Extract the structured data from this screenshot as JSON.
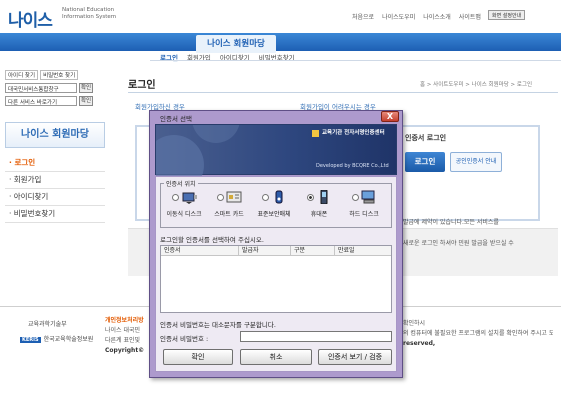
{
  "header": {
    "logo_ko": "나이스",
    "logo_en_line1": "National Education",
    "logo_en_line2": "Information System",
    "links": [
      "처음으로",
      "나이스도우미",
      "나이스소개",
      "사이트맵"
    ],
    "lang_button": "화면 설정안내"
  },
  "nav": {
    "items": [
      "사이트 이용안내",
      "나이스 회원마당",
      "본인인증안내",
      "사이트운영방침"
    ],
    "active_index": 1,
    "sub_items": [
      "로그인",
      "회원가입",
      "아이디찾기",
      "비밀번호찾기"
    ],
    "sub_active_index": 0
  },
  "sidebar": {
    "tabs": [
      "아이디 찾기",
      "비밀번호 찾기"
    ],
    "row1_select": "대국민서비스통합창구",
    "row2_select": "다른 서비스 바로가기",
    "confirm": "확인",
    "title": "나이스 회원마당",
    "menu": [
      "로그인",
      "회원가입",
      "아이디찾기",
      "비밀번호찾기"
    ],
    "menu_active_index": 0
  },
  "main": {
    "heading": "로그인",
    "breadcrumb": "홈 > 사이트도우미 > 나이스 회원마당 > 로그인",
    "left_blue": "회원가입하신 경우",
    "right_blue": "회원가입이 어려우시는 경우",
    "cert_panel_title": "인증서 로그인",
    "cert_button": "로그인",
    "guide_button": "공인인증서 안내",
    "notice_line1": "발급에 제약이 있습니다.모든 서비스를",
    "notice_line2": "새로운 로그인 하셔야 민원 발급을 받으실 수"
  },
  "footer": {
    "org1": "교육과학기술부",
    "org2_badge": "KERIS",
    "org2": "한국교육학술정보원",
    "privacy": "개인정보처리방",
    "text1": "나이스 대국민",
    "text2": "다른계 표인및",
    "copyright": "Copyright©",
    "right1": "확인하시",
    "right2": "의 컴퓨터에 불필요한 프로그램의 설치를 확인하여 주시고 도움말과 함께 사용하여 주십시오",
    "right3": "reserved,"
  },
  "dialog": {
    "title": "인증서 선택",
    "close_label": "X",
    "banner_title": "교육기관 전자서명인증센터",
    "banner_dev": "Developed by BCQRE Co.,Ltd",
    "group_label": "인증서 위치",
    "devices": [
      {
        "label": "이동식 디스크",
        "icon": "usb-disk-icon",
        "checked": false
      },
      {
        "label": "스마트 카드",
        "icon": "smart-card-icon",
        "checked": false
      },
      {
        "label": "표준보안매체",
        "icon": "security-token-icon",
        "checked": false
      },
      {
        "label": "휴대폰",
        "icon": "mobile-phone-icon",
        "checked": true
      },
      {
        "label": "하드 디스크",
        "icon": "hard-disk-icon",
        "checked": false
      }
    ],
    "select_msg": "로그인할 인증서를 선택하여 주십시오.",
    "columns": [
      "인증서",
      "발급자",
      "구분",
      "만료일"
    ],
    "pw_hint": "인증서 비밀번호는 대소문자를 구분합니다.",
    "pw_label": "인증서 비밀번호 :",
    "buttons": [
      "확인",
      "취소",
      "인증서 보기 / 검증"
    ]
  },
  "colors": {
    "nav_blue": "#1d5fb3",
    "accent_orange": "#e35a00",
    "dialog_frame": "#ad9acd"
  }
}
